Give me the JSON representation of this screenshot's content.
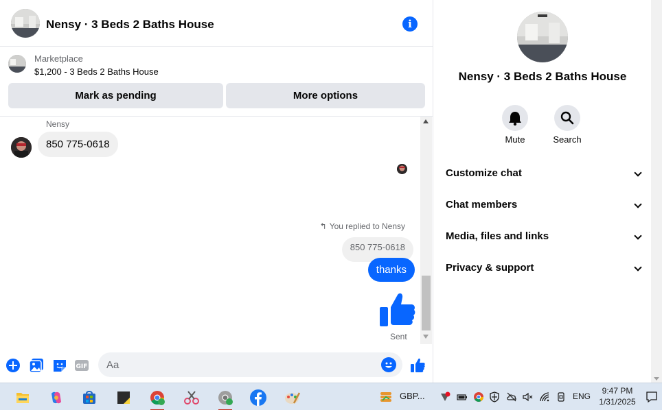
{
  "chat": {
    "title": "Nensy · 3 Beds 2 Baths House",
    "info_icon": "info-icon"
  },
  "marketplace": {
    "label": "Marketplace",
    "item": "$1,200 - 3 Beds 2 Baths House",
    "mark_pending": "Mark as pending",
    "more_options": "More options"
  },
  "messages": {
    "sender_name": "Nensy",
    "incoming_text": "850 775-0618",
    "replied_label": "You replied to Nensy",
    "quoted_text": "850 775-0618",
    "outgoing_text": "thanks",
    "status": "Sent"
  },
  "composer": {
    "placeholder": "Aa",
    "gif_label": "GIF"
  },
  "details": {
    "title": "Nensy · 3 Beds 2 Baths House",
    "actions": [
      {
        "label": "Mute",
        "icon": "bell-icon"
      },
      {
        "label": "Search",
        "icon": "search-icon"
      }
    ],
    "sections": [
      {
        "label": "Customize chat"
      },
      {
        "label": "Chat members"
      },
      {
        "label": "Media, files and links"
      },
      {
        "label": "Privacy & support"
      }
    ]
  },
  "taskbar": {
    "weather_text": "GBP...",
    "language": "ENG",
    "time": "9:47 PM",
    "date": "1/31/2025"
  },
  "colors": {
    "accent": "#0866ff",
    "bubble_in": "#f0f0f0",
    "button_bg": "#e4e6eb",
    "taskbar_bg": "#dce6f2"
  }
}
